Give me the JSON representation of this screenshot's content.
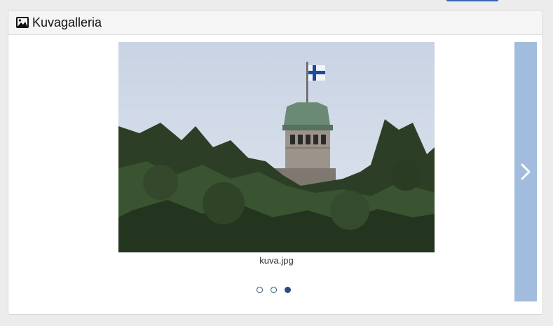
{
  "panel": {
    "title": "Kuvagalleria",
    "icon": "image-icon"
  },
  "carousel": {
    "caption": "kuva.jpg",
    "next_icon": "chevron-right-icon",
    "slide_count": 3,
    "active_index": 2
  },
  "colors": {
    "next_button_bg": "#a1bcdd",
    "indicator": "#2a4d7a",
    "top_button": "#3a63b2"
  }
}
